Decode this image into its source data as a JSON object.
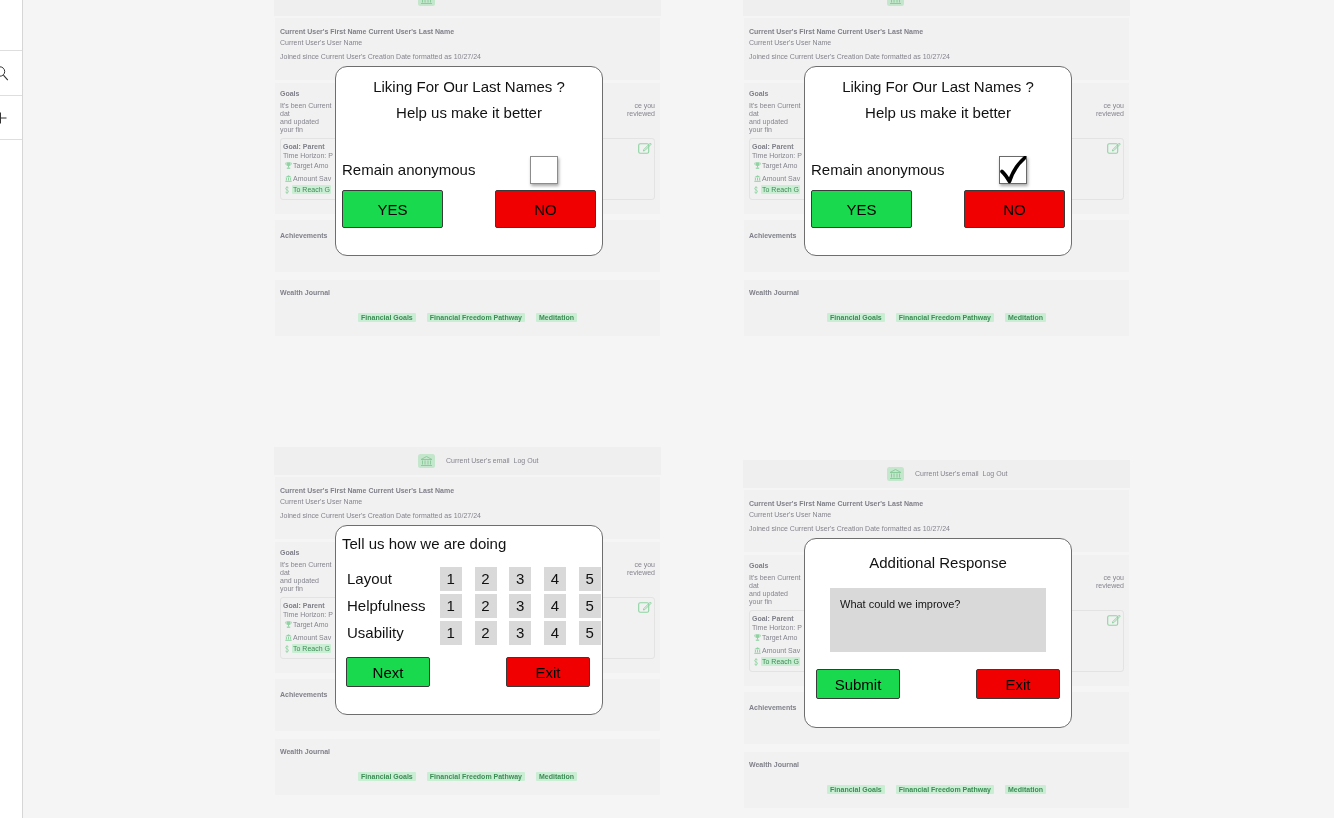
{
  "frames": [
    {
      "screen": {
        "profile": {
          "name": "Current User's First Name Current User's Last Name",
          "username": "Current User's User Name",
          "joined": "Joined since Current User's Creation Date formatted as 10/27/24"
        },
        "goals": {
          "title": "Goals",
          "intro_left": [
            "It's been Current dat",
            "and updated your fin"
          ],
          "intro_right": "ce you reviewed",
          "goal": {
            "title": "Goal: Parent",
            "time_horizon": "Time Horizon: P",
            "target": "Target Amo",
            "saved": "Amount Sav",
            "badge": "To Reach G"
          }
        },
        "achievements": {
          "title": "Achievements"
        },
        "wealth_journal": {
          "title": "Wealth Journal",
          "tags": [
            "Financial Goals",
            "Financial Freedom Pathway",
            "Meditation"
          ]
        }
      },
      "dialog": {
        "kind": "consent",
        "title": "Liking For Our Last Names ?",
        "subtitle": "Help us make it better",
        "option": {
          "label": "Remain anonymous",
          "checked": false
        },
        "buttons": [
          {
            "label": "YES",
            "kind": "confirm"
          },
          {
            "label": "NO",
            "kind": "cancel"
          }
        ]
      }
    },
    {
      "screen": {
        "profile": {
          "name": "Current User's First Name Current User's Last Name",
          "username": "Current User's User Name",
          "joined": "Joined since Current User's Creation Date formatted as 10/27/24"
        },
        "goals": {
          "title": "Goals",
          "intro_left": [
            "It's been Current dat",
            "and updated your fin"
          ],
          "intro_right": "ce you reviewed",
          "goal": {
            "title": "Goal: Parent",
            "time_horizon": "Time Horizon: P",
            "target": "Target Amo",
            "saved": "Amount Sav",
            "badge": "To Reach G"
          }
        },
        "achievements": {
          "title": "Achievements"
        },
        "wealth_journal": {
          "title": "Wealth Journal",
          "tags": [
            "Financial Goals",
            "Financial Freedom Pathway",
            "Meditation"
          ]
        }
      },
      "dialog": {
        "kind": "consent",
        "title": "Liking For Our Last Names ?",
        "subtitle": "Help us make it better",
        "option": {
          "label": "Remain anonymous",
          "checked": true
        },
        "buttons": [
          {
            "label": "YES",
            "kind": "confirm"
          },
          {
            "label": "NO",
            "kind": "cancel"
          }
        ]
      }
    },
    {
      "screen": {
        "header": {
          "email": "Current User's email",
          "logout": "Log Out"
        },
        "profile": {
          "name": "Current User's First Name Current User's Last Name",
          "username": "Current User's User Name",
          "joined": "Joined since Current User's Creation Date formatted as 10/27/24"
        },
        "goals": {
          "title": "Goals",
          "intro_left": [
            "It's been Current dat",
            "and updated your fin"
          ],
          "intro_right": "ce you reviewed",
          "goal": {
            "title": "Goal: Parent",
            "time_horizon": "Time Horizon: P",
            "target": "Target Amo",
            "saved": "Amount Sav",
            "badge": "To Reach G"
          }
        },
        "achievements": {
          "title": "Achievements"
        },
        "wealth_journal": {
          "title": "Wealth Journal",
          "tags": [
            "Financial Goals",
            "Financial Freedom Pathway",
            "Meditation"
          ]
        }
      },
      "dialog": {
        "kind": "rating",
        "title": "Tell us how we are doing",
        "rows": [
          {
            "label": "Layout",
            "options": [
              {
                "label": "1",
                "selected": false
              },
              {
                "label": "2",
                "selected": false
              },
              {
                "label": "3",
                "selected": false
              },
              {
                "label": "4",
                "selected": false
              },
              {
                "label": "5",
                "selected": false
              }
            ]
          },
          {
            "label": "Helpfulness",
            "options": [
              {
                "label": "1",
                "selected": false
              },
              {
                "label": "2",
                "selected": false
              },
              {
                "label": "3",
                "selected": false
              },
              {
                "label": "4",
                "selected": false
              },
              {
                "label": "5",
                "selected": false
              }
            ]
          },
          {
            "label": "Usability",
            "options": [
              {
                "label": "1",
                "selected": false
              },
              {
                "label": "2",
                "selected": false
              },
              {
                "label": "3",
                "selected": false
              },
              {
                "label": "4",
                "selected": false
              },
              {
                "label": "5",
                "selected": false
              }
            ]
          }
        ],
        "buttons": [
          {
            "label": "Next",
            "kind": "confirm"
          },
          {
            "label": "Exit",
            "kind": "cancel"
          }
        ]
      }
    },
    {
      "screen": {
        "header": {
          "email": "Current User's email",
          "logout": "Log Out"
        },
        "profile": {
          "name": "Current User's First Name Current User's Last Name",
          "username": "Current User's User Name",
          "joined": "Joined since Current User's Creation Date formatted as 10/27/24"
        },
        "goals": {
          "title": "Goals",
          "intro_left": [
            "It's been Current dat",
            "and updated your fin"
          ],
          "intro_right": "ce you reviewed",
          "goal": {
            "title": "Goal: Parent",
            "time_horizon": "Time Horizon: P",
            "target": "Target Amo",
            "saved": "Amount Sav",
            "badge": "To Reach G"
          }
        },
        "achievements": {
          "title": "Achievements"
        },
        "wealth_journal": {
          "title": "Wealth Journal",
          "tags": [
            "Financial Goals",
            "Financial Freedom Pathway",
            "Meditation"
          ]
        }
      },
      "dialog": {
        "kind": "response",
        "title": "Additional Response",
        "field": {
          "placeholder": "What could we improve?"
        },
        "buttons": [
          {
            "label": "Submit",
            "kind": "confirm"
          },
          {
            "label": "Exit",
            "kind": "cancel"
          }
        ]
      }
    }
  ]
}
